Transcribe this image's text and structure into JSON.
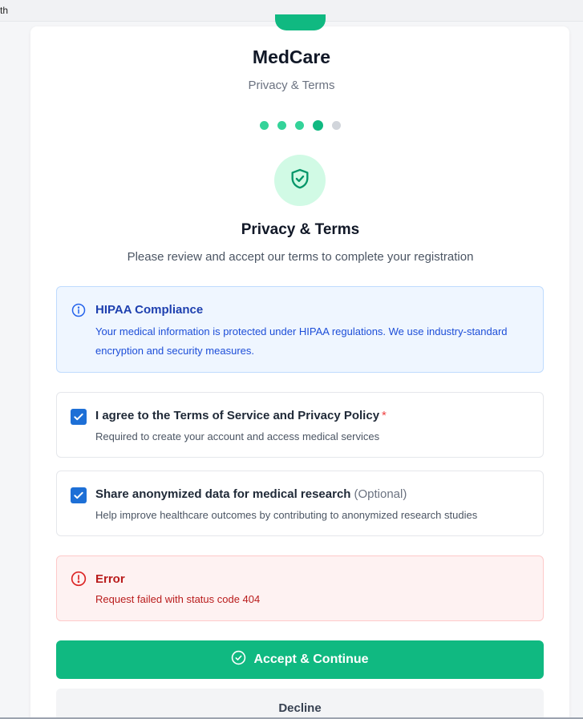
{
  "browser": {
    "url_fragment": "th"
  },
  "header": {
    "brand": "MedCare",
    "subtitle": "Privacy & Terms",
    "steps": {
      "total": 5,
      "completed": 3,
      "current": 4
    }
  },
  "section": {
    "icon": "shield-check-icon",
    "title": "Privacy & Terms",
    "description": "Please review and accept our terms to complete your registration"
  },
  "notice": {
    "icon": "info-icon",
    "title": "HIPAA Compliance",
    "text": "Your medical information is protected under HIPAA regulations. We use industry-standard encryption and security measures."
  },
  "consents": [
    {
      "label": "I agree to the Terms of Service and Privacy Policy",
      "required_marker": "*",
      "help": "Required to create your account and access medical services",
      "checked": true
    },
    {
      "label": "Share anonymized data for medical research",
      "optional_marker": "(Optional)",
      "help": "Help improve healthcare outcomes by contributing to anonymized research studies",
      "checked": true
    }
  ],
  "error": {
    "icon": "alert-circle-icon",
    "title": "Error",
    "message": "Request failed with status code 404"
  },
  "actions": {
    "accept_label": "Accept & Continue",
    "accept_icon": "check-circle-icon",
    "decline_label": "Decline"
  },
  "colors": {
    "brand": "#10b981",
    "info_bg": "#eff6ff",
    "error_bg": "#fef2f2",
    "checkbox": "#1d6fd6"
  }
}
